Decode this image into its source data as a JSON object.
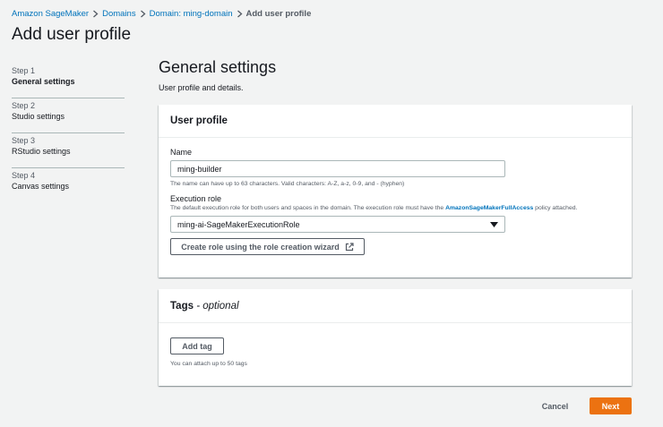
{
  "breadcrumb": {
    "items": [
      "Amazon SageMaker",
      "Domains",
      "Domain: ming-domain"
    ],
    "current": "Add user profile"
  },
  "page_title": "Add user profile",
  "steps": [
    {
      "num": "Step 1",
      "label": "General settings",
      "active": true
    },
    {
      "num": "Step 2",
      "label": "Studio settings",
      "active": false
    },
    {
      "num": "Step 3",
      "label": "RStudio settings",
      "active": false
    },
    {
      "num": "Step 4",
      "label": "Canvas settings",
      "active": false
    }
  ],
  "main": {
    "title": "General settings",
    "description": "User profile and details."
  },
  "user_profile": {
    "header": "User profile",
    "name_label": "Name",
    "name_value": "ming-builder",
    "name_hint": "The name can have up to 63 characters. Valid characters: A-Z, a-z, 0-9, and - (hyphen)",
    "role_label": "Execution role",
    "role_desc_prefix": "The default execution role for both users and spaces in the domain. The execution role must have the",
    "role_desc_policy": "AmazonSageMakerFullAccess",
    "role_desc_suffix": "policy attached.",
    "role_value": "ming-ai-SageMakerExecutionRole",
    "create_role_button": "Create role using the role creation wizard"
  },
  "tags": {
    "header": "Tags",
    "header_optional": "optional",
    "header_sep": " - ",
    "add_tag_button": "Add tag",
    "hint": "You can attach up to 50 tags"
  },
  "footer": {
    "cancel": "Cancel",
    "next": "Next"
  },
  "colors": {
    "accent": "#ec7211",
    "link": "#0073bb",
    "background": "#f2f3f3"
  }
}
